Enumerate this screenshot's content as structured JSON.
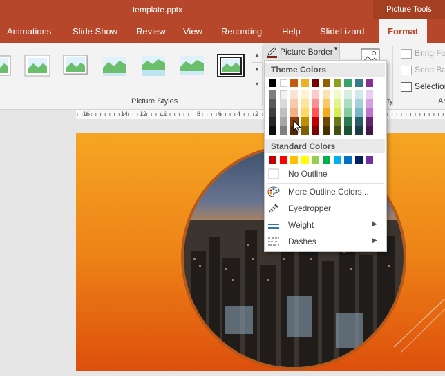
{
  "title_bar": {
    "document": "template.pptx",
    "context_tab": "Picture Tools"
  },
  "tabs": [
    {
      "label": "Animations",
      "name": "animations"
    },
    {
      "label": "Slide Show",
      "name": "slide-show"
    },
    {
      "label": "Review",
      "name": "review"
    },
    {
      "label": "View",
      "name": "view"
    },
    {
      "label": "Recording",
      "name": "recording"
    },
    {
      "label": "Help",
      "name": "help"
    },
    {
      "label": "SlideLizard",
      "name": "slidelizard"
    },
    {
      "label": "Format",
      "name": "format",
      "active": true
    }
  ],
  "ribbon": {
    "picture_styles_label": "Picture Styles",
    "picture_border_label": "Picture Border",
    "accessibility_label_fragment": "ity",
    "arrange_label_fragment": "Ar",
    "arrange_items": [
      "Bring Fo",
      "Send Ba",
      "Selection"
    ]
  },
  "ruler": {
    "labels": [
      "16",
      "14",
      "12",
      "10",
      "8",
      "6",
      "4",
      "2"
    ]
  },
  "dropdown": {
    "theme_header": "Theme Colors",
    "standard_header": "Standard Colors",
    "theme_rows": [
      [
        "#000000",
        "#ffffff",
        "#c55a11",
        "#ebb024",
        "#7a0000",
        "#926100",
        "#8ba21e",
        "#37a26b",
        "#357a8a",
        "#8a2f92"
      ],
      [
        "#7f7f7f",
        "#f2f2f2",
        "#fbe4d5",
        "#fff2cc",
        "#ffc7c7",
        "#fce4b0",
        "#f2f8c6",
        "#d5eedf",
        "#d3e7ec",
        "#ead0f0"
      ],
      [
        "#595959",
        "#d9d9d9",
        "#f7caac",
        "#ffe599",
        "#ff8f8f",
        "#f9c763",
        "#e4f28c",
        "#acdcbf",
        "#a6cfd9",
        "#d5a1e0"
      ],
      [
        "#3f3f3f",
        "#bfbfbf",
        "#f4b183",
        "#ffd965",
        "#ff5555",
        "#f4ab17",
        "#d7eb52",
        "#83cb9f",
        "#7ab7c6",
        "#c072d1"
      ],
      [
        "#262626",
        "#a6a6a6",
        "#843c0c",
        "#bf8f00",
        "#c00000",
        "#6d4800",
        "#687a16",
        "#297a50",
        "#285c67",
        "#67236d"
      ],
      [
        "#0d0d0d",
        "#7f7f7f",
        "#562707",
        "#7f6000",
        "#800000",
        "#493000",
        "#45510f",
        "#1c5135",
        "#1b3d45",
        "#451749"
      ]
    ],
    "standard_colors": [
      "#c00000",
      "#ff0000",
      "#ffc000",
      "#ffff00",
      "#92d050",
      "#00b050",
      "#00b0f0",
      "#0070c0",
      "#002060",
      "#7030a0"
    ],
    "items": [
      {
        "label": "No Outline",
        "icon": "no-outline-icon"
      },
      {
        "label": "More Outline Colors...",
        "icon": "palette-icon"
      },
      {
        "label": "Eyedropper",
        "icon": "eyedropper-icon"
      },
      {
        "label": "Weight",
        "icon": "weight-lines-icon",
        "submenu": true
      },
      {
        "label": "Dashes",
        "icon": "dashes-icon",
        "submenu": true
      }
    ]
  },
  "colors": {
    "accent": "#b7472a",
    "photo_border": "#b5581b"
  }
}
